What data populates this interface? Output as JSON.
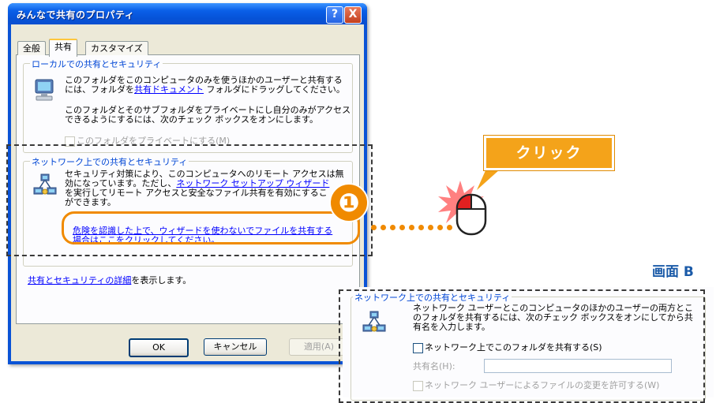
{
  "dialog": {
    "title": "みんなで共有のプロパティ",
    "help_symbol": "?",
    "close_symbol": "X",
    "tabs": [
      {
        "label": "全般"
      },
      {
        "label": "共有"
      },
      {
        "label": "カスタマイズ"
      }
    ],
    "local_group": {
      "legend": "ローカルでの共有とセキュリティ",
      "text1_line1": "このフォルダをこのコンピュータのみを使うほかのユーザーと共有する",
      "text1_prefix": "には、フォルダを",
      "text1_link": "共有ドキュメント",
      "text1_suffix": " フォルダにドラッグしてください。",
      "text2_line1": "このフォルダとそのサブフォルダをプライベートにし自分のみがアクセス",
      "text2_line2": "できるようにするには、次のチェック ボックスをオンにします。",
      "private_checkbox_label": "このフォルダをプライベートにする(M)"
    },
    "network_group": {
      "legend": "ネットワーク上での共有とセキュリティ",
      "line1": "セキュリティ対策により、このコンピュータへのリモート アクセスは無",
      "line2_prefix": "効になっています。ただし、",
      "line2_link": "ネットワーク セットアップ ウィザード",
      "line3": "を実行してリモート アクセスと安全なファイル共有を有効にするこ",
      "line4": "ができます。",
      "risk_link_line1": "危険を認識した上で、ウィザードを使わないでファイルを共有する",
      "risk_link_line2": "場合はここをクリックしてください。"
    },
    "details_link": "共有とセキュリティの詳細",
    "details_suffix": "を表示します。",
    "ok_label": "OK",
    "cancel_label": "キャンセル",
    "apply_label": "適用(A)"
  },
  "annotation": {
    "callout": "クリック",
    "step_number": "❶",
    "accent_color": "#f08a00"
  },
  "screen_b": {
    "label": "画面 B",
    "legend": "ネットワーク上での共有とセキュリティ",
    "line1": "ネットワーク ユーザーとこのコンピュータのほかのユーザーの両方とこ",
    "line2": "のフォルダを共有するには、次のチェック ボックスをオンにしてから共",
    "line3": "有名を入力します。",
    "share_checkbox_label": "ネットワーク上でこのフォルダを共有する(S)",
    "share_name_label": "共有名(H):",
    "share_name_value": "",
    "allow_change_label": "ネットワーク ユーザーによるファイルの変更を許可する(W)"
  }
}
